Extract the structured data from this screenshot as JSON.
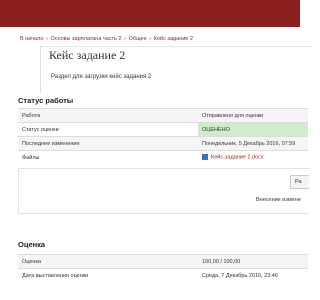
{
  "breadcrumb": {
    "items": [
      "В начало",
      "Основы зарплатана часть 2",
      "Общее",
      "Кейс задание 2"
    ]
  },
  "page": {
    "title": "Кейс задание 2",
    "description": "Раздел для загрузки кейс задания 2"
  },
  "status": {
    "heading": "Статус работы",
    "rows": [
      {
        "label": "Работа",
        "value": "Отправлено для оценки"
      },
      {
        "label": "Статус оценки",
        "value": "ОЦЕНЕНО"
      },
      {
        "label": "Последнее изменение",
        "value": "Понедельник, 5 Декабрь 2016, 07:59"
      },
      {
        "label": "Файлы",
        "value": "Кейс-задание 2.docx"
      }
    ],
    "panel_button": "Ра",
    "panel_note": "Внесение измене"
  },
  "grade": {
    "heading": "Оценка",
    "rows": [
      {
        "label": "Оценка",
        "value": "100,00 / 100,00"
      },
      {
        "label": "Дата выставления оценки",
        "value": "Среда, 7 Декабрь 2016, 23:46"
      }
    ]
  },
  "colors": {
    "brand": "#8e1f1f",
    "graded_bg": "#cfeccb"
  },
  "icons": {
    "file": "word-file-icon"
  }
}
